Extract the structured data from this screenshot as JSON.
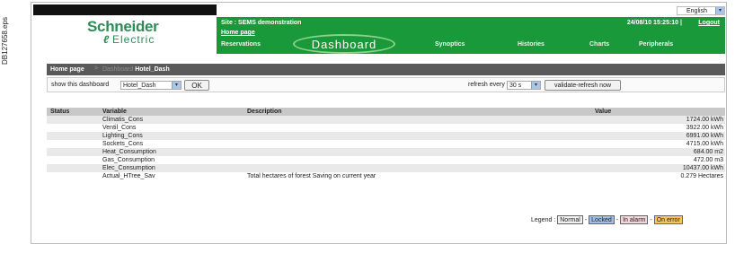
{
  "figure_code": "DB127658.eps",
  "header": {
    "language": "English",
    "site_title": "Site : SEMS demonstration",
    "datetime": "24/08/10 15:25:10",
    "separator": "|",
    "logout": "Logout",
    "home_link": "Home page",
    "logo": {
      "line1": "Schneider",
      "line2": "Electric"
    }
  },
  "nav": {
    "reservations": "Reservations",
    "dashboard": "Dashboard",
    "synoptics": "Synoptics",
    "histories": "Histories",
    "charts": "Charts",
    "peripherals": "Peripherals"
  },
  "breadcrumb": {
    "home": "Home page",
    "sep": ">",
    "dim": "Dashboard",
    "current": "Hotel_Dash"
  },
  "controls": {
    "show_label": "show this dashboard",
    "dashboard_value": "Hotel_Dash",
    "ok": "OK",
    "refresh_label": "refresh every",
    "refresh_value": "30 s",
    "validate": "validate-refresh now"
  },
  "table": {
    "headers": {
      "status": "Status",
      "variable": "Variable",
      "description": "Description",
      "value": "Value"
    },
    "rows": [
      {
        "variable": "Climatis_Cons",
        "description": "",
        "value": "1724.00 kWh"
      },
      {
        "variable": "Ventil_Cons",
        "description": "",
        "value": "3922.00 kWh"
      },
      {
        "variable": "Lighting_Cons",
        "description": "",
        "value": "6991.00 kWh"
      },
      {
        "variable": "Sockets_Cons",
        "description": "",
        "value": "4715.00 kWh"
      },
      {
        "variable": "Heat_Consumption",
        "description": "",
        "value": "684.00 m2"
      },
      {
        "variable": "Gas_Consumption",
        "description": "",
        "value": "472.00 m3"
      },
      {
        "variable": "Elec_Consumption",
        "description": "",
        "value": "10437.00 kWh"
      },
      {
        "variable": "Actual_HTree_Sav",
        "description": "Total hectares of forest Saving on current year",
        "value": "0.279 Hectares"
      }
    ]
  },
  "legend": {
    "label": "Legend :",
    "normal": "Normal",
    "locked": "Locked",
    "alarm": "In alarm",
    "error": "On error",
    "dash": "-"
  },
  "colors": {
    "header_green": "#19993a",
    "breadcrumb_bar": "#5a5a5a",
    "locked": "#9ec0e6",
    "alarm": "#f7d4dc",
    "error": "#f5c45a"
  }
}
